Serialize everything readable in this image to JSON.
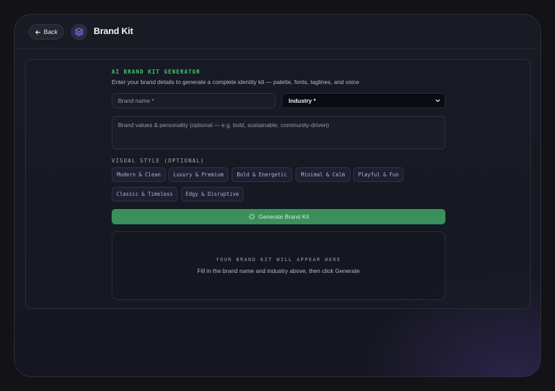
{
  "header": {
    "back_label": "Back",
    "title": "Brand Kit",
    "logo_icon": "layers-icon"
  },
  "generator": {
    "kicker": "AI BRAND KIT GENERATOR",
    "subtitle": "Enter your brand details to generate a complete identity kit — palette, fonts, taglines, and voice",
    "brand_name": {
      "value": "",
      "placeholder": "Brand name *"
    },
    "industry": {
      "selected": "Industry *"
    },
    "values": {
      "value": "",
      "placeholder": "Brand values & personality (optional — e.g. bold, sustainable, community-driven)"
    },
    "style_label": "VISUAL STYLE (OPTIONAL)",
    "styles": [
      "Modern & Clean",
      "Luxury & Premium",
      "Bold & Energetic",
      "Minimal & Calm",
      "Playful & Fun",
      "Classic & Timeless",
      "Edgy & Disruptive"
    ],
    "generate_label": "Generate Brand Kit",
    "output_title": "YOUR BRAND KIT WILL APPEAR HERE",
    "output_hint": "Fill in the brand name and industry above, then click Generate"
  },
  "colors": {
    "accent_green": "#3a8f5a",
    "kicker_green": "#3fcf6e",
    "logo_purple": "#8b7cf6"
  }
}
